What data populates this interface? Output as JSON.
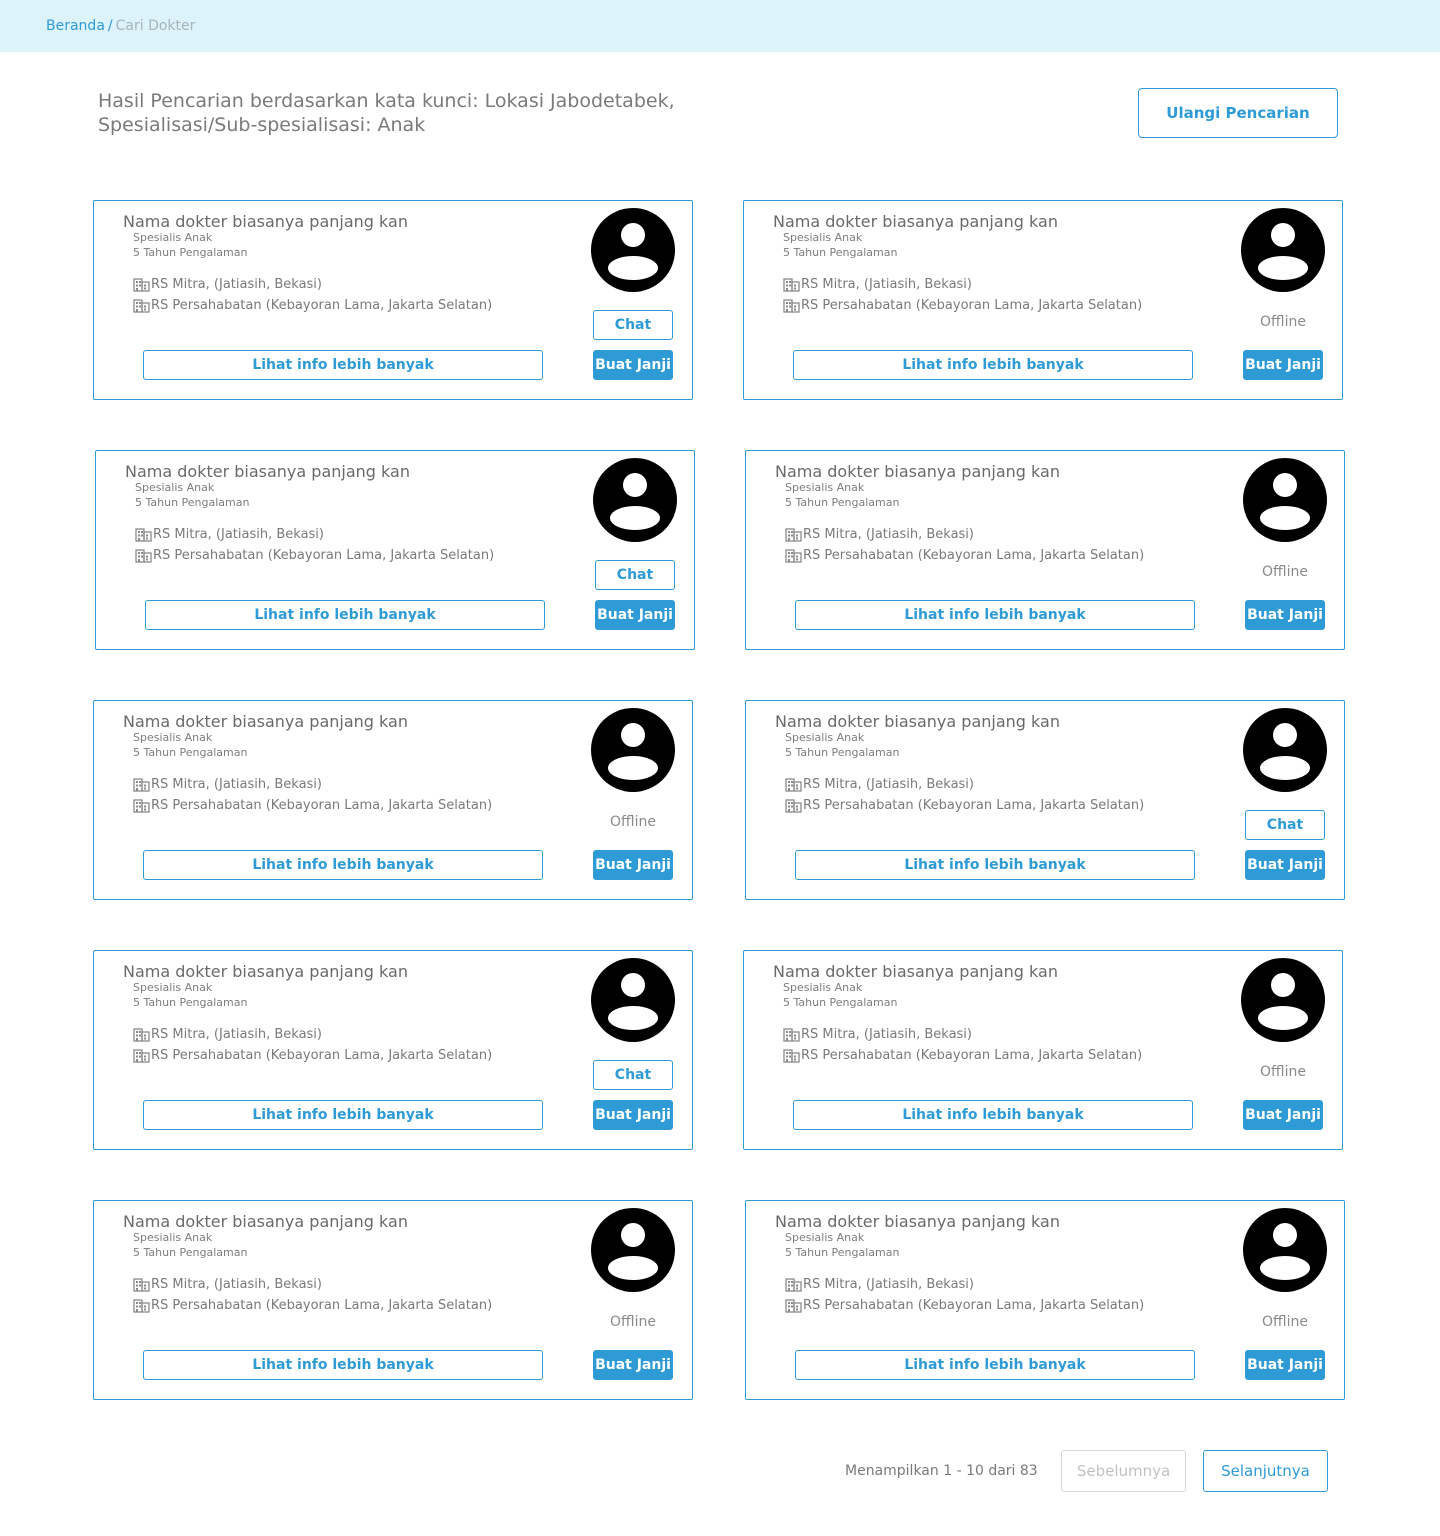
{
  "breadcrumb": {
    "home": "Beranda",
    "separator": "/",
    "current": "Cari Dokter"
  },
  "search": {
    "heading_line1": "Hasil Pencarian berdasarkan kata kunci: Lokasi Jabodetabek,",
    "heading_line2": "Spesialisasi/Sub-spesialisasi: Anak",
    "retry_label": "Ulangi Pencarian"
  },
  "colors": {
    "accent": "#2e9bd6",
    "topbar": "#dcf3fa",
    "text": "#6f6f6f"
  },
  "labels": {
    "more_info": "Lihat info lebih banyak",
    "book": "Buat Janji",
    "chat": "Chat",
    "offline": "Offline",
    "building_icon": "building-icon",
    "avatar_icon": "account-circle-icon"
  },
  "doctors": [
    {
      "name": "Nama dokter biasanya panjang kan",
      "specialty": "Spesialis Anak",
      "experience": "5 Tahun Pengalaman",
      "hospitals": [
        "RS Mitra, (Jatiasih, Bekasi)",
        "RS Persahabatan (Kebayoran Lama, Jakarta Selatan)"
      ],
      "status": "online"
    },
    {
      "name": "Nama dokter biasanya panjang kan",
      "specialty": "Spesialis Anak",
      "experience": "5 Tahun Pengalaman",
      "hospitals": [
        "RS Mitra, (Jatiasih, Bekasi)",
        "RS Persahabatan (Kebayoran Lama, Jakarta Selatan)"
      ],
      "status": "offline"
    },
    {
      "name": "Nama dokter biasanya panjang kan",
      "specialty": "Spesialis Anak",
      "experience": "5 Tahun Pengalaman",
      "hospitals": [
        "RS Mitra, (Jatiasih, Bekasi)",
        "RS Persahabatan (Kebayoran Lama, Jakarta Selatan)"
      ],
      "status": "online"
    },
    {
      "name": "Nama dokter biasanya panjang kan",
      "specialty": "Spesialis Anak",
      "experience": "5 Tahun Pengalaman",
      "hospitals": [
        "RS Mitra, (Jatiasih, Bekasi)",
        "RS Persahabatan (Kebayoran Lama, Jakarta Selatan)"
      ],
      "status": "offline"
    },
    {
      "name": "Nama dokter biasanya panjang kan",
      "specialty": "Spesialis Anak",
      "experience": "5 Tahun Pengalaman",
      "hospitals": [
        "RS Mitra, (Jatiasih, Bekasi)",
        "RS Persahabatan (Kebayoran Lama, Jakarta Selatan)"
      ],
      "status": "offline"
    },
    {
      "name": "Nama dokter biasanya panjang kan",
      "specialty": "Spesialis Anak",
      "experience": "5 Tahun Pengalaman",
      "hospitals": [
        "RS Mitra, (Jatiasih, Bekasi)",
        "RS Persahabatan (Kebayoran Lama, Jakarta Selatan)"
      ],
      "status": "online"
    },
    {
      "name": "Nama dokter biasanya panjang kan",
      "specialty": "Spesialis Anak",
      "experience": "5 Tahun Pengalaman",
      "hospitals": [
        "RS Mitra, (Jatiasih, Bekasi)",
        "RS Persahabatan (Kebayoran Lama, Jakarta Selatan)"
      ],
      "status": "online"
    },
    {
      "name": "Nama dokter biasanya panjang kan",
      "specialty": "Spesialis Anak",
      "experience": "5 Tahun Pengalaman",
      "hospitals": [
        "RS Mitra, (Jatiasih, Bekasi)",
        "RS Persahabatan (Kebayoran Lama, Jakarta Selatan)"
      ],
      "status": "offline"
    },
    {
      "name": "Nama dokter biasanya panjang kan",
      "specialty": "Spesialis Anak",
      "experience": "5 Tahun Pengalaman",
      "hospitals": [
        "RS Mitra, (Jatiasih, Bekasi)",
        "RS Persahabatan (Kebayoran Lama, Jakarta Selatan)"
      ],
      "status": "offline"
    },
    {
      "name": "Nama dokter biasanya panjang kan",
      "specialty": "Spesialis Anak",
      "experience": "5 Tahun Pengalaman",
      "hospitals": [
        "RS Mitra, (Jatiasih, Bekasi)",
        "RS Persahabatan (Kebayoran Lama, Jakarta Selatan)"
      ],
      "status": "offline"
    }
  ],
  "pagination": {
    "info": "Menampilkan 1 - 10 dari 83",
    "prev_label": "Sebelumnya",
    "next_label": "Selanjutnya"
  }
}
